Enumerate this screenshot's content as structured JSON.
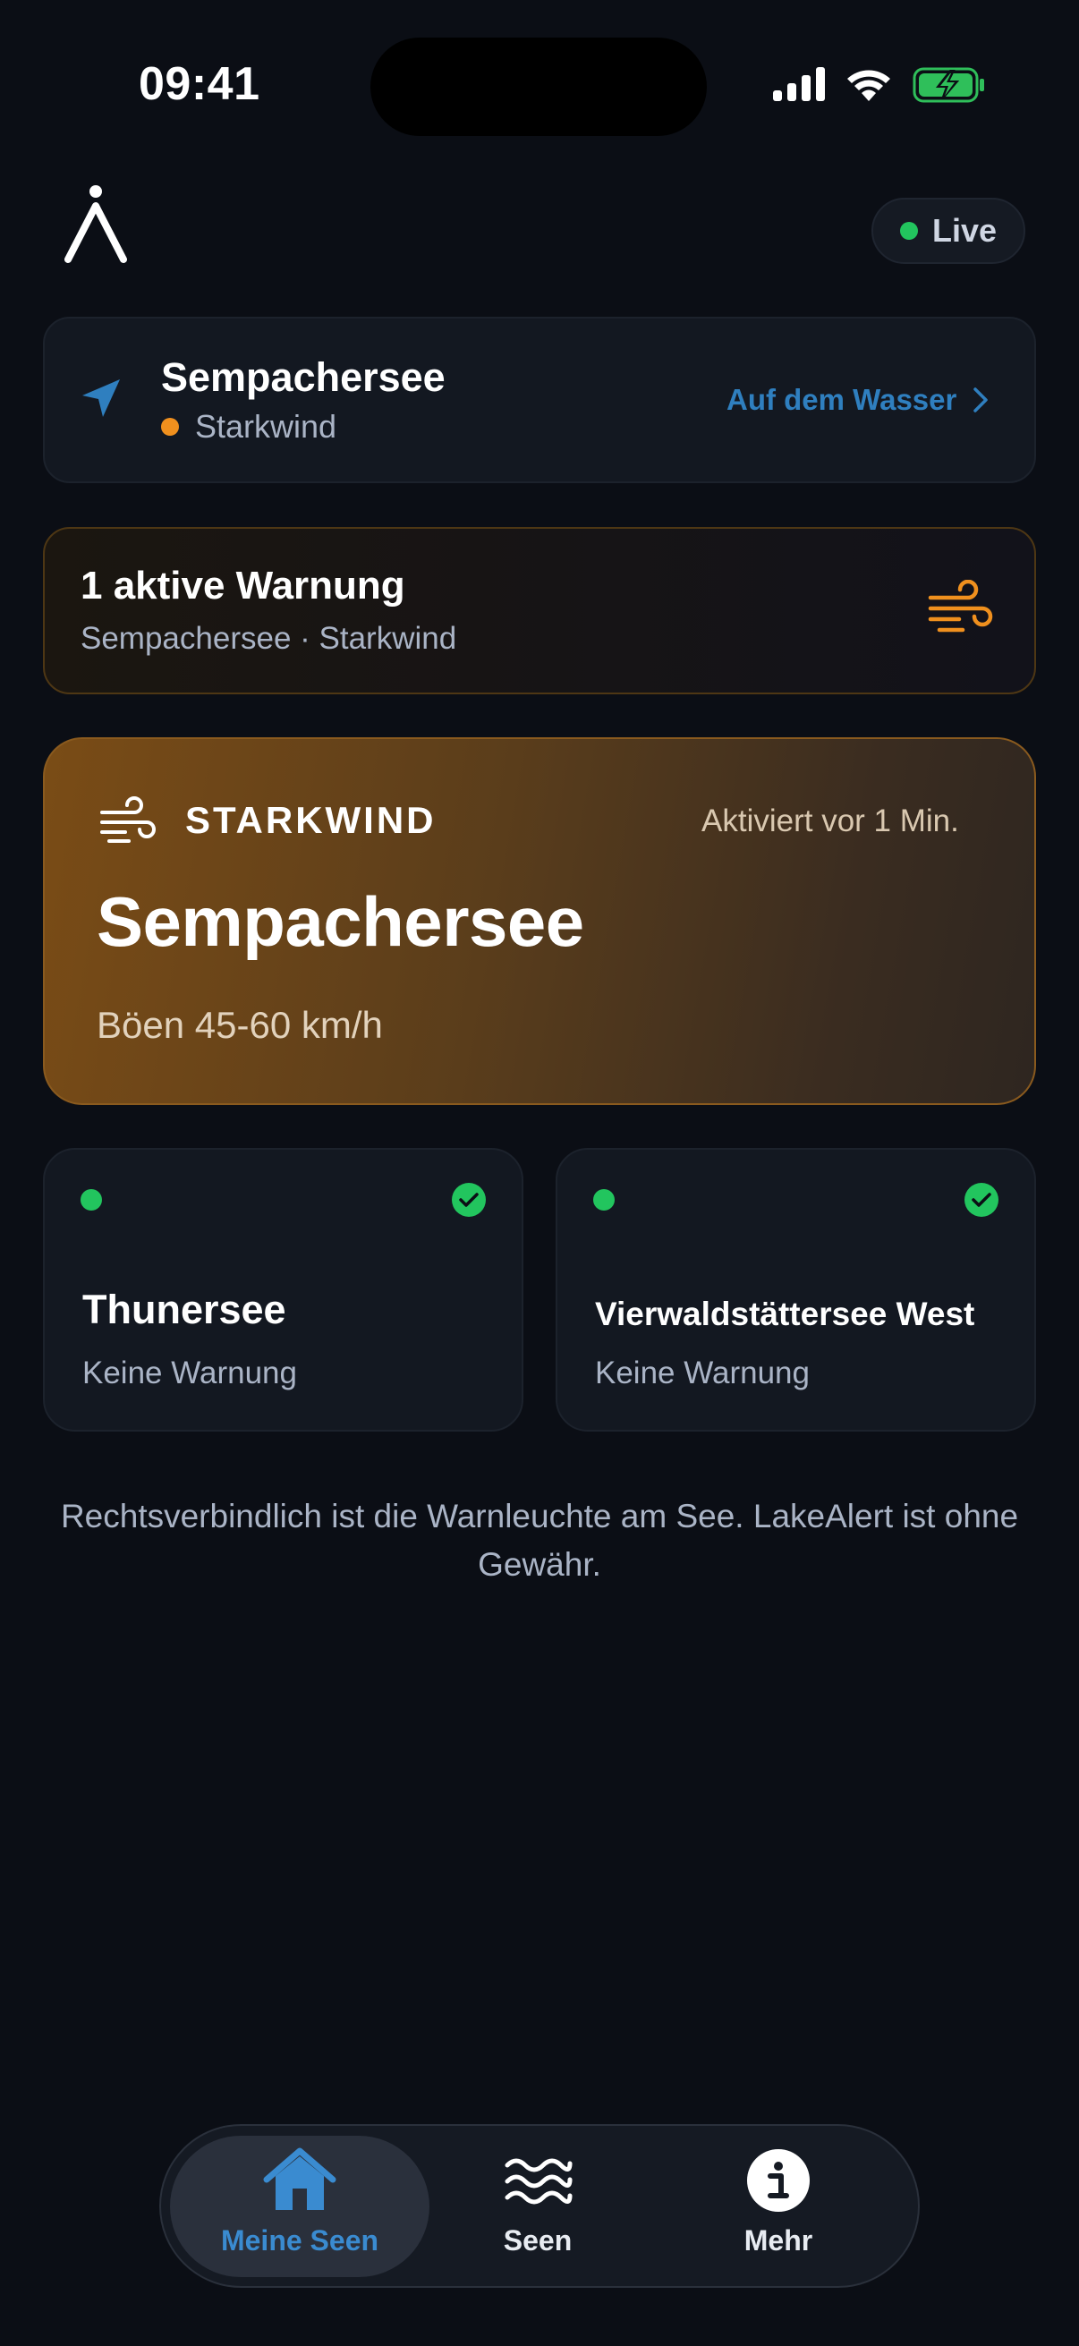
{
  "status_bar": {
    "time": "09:41"
  },
  "header": {
    "logo_icon": "a-ring-logo-icon",
    "live_label": "Live"
  },
  "location": {
    "lake": "Sempachersee",
    "status": "Starkwind",
    "status_color": "#f0901e",
    "action_label": "Auf dem Wasser"
  },
  "warning_summary": {
    "title": "1 aktive Warnung",
    "subtitle": "Sempachersee · Starkwind",
    "icon": "wind-icon"
  },
  "alert": {
    "type_label": "STARKWIND",
    "activated": "Aktiviert vor 1 Min.",
    "lake": "Sempachersee",
    "detail": "Böen 45-60 km/h"
  },
  "lakes": [
    {
      "name": "Thunersee",
      "status": "Keine Warnung",
      "status_color": "#22c55e"
    },
    {
      "name": "Vierwaldstättersee West",
      "status": "Keine Warnung",
      "status_color": "#22c55e"
    }
  ],
  "disclaimer": "Rechtsverbindlich ist die Warnleuchte am See. LakeAlert ist ohne Gewähr.",
  "tabs": [
    {
      "label": "Meine Seen",
      "icon": "home-icon",
      "active": true
    },
    {
      "label": "Seen",
      "icon": "waves-icon",
      "active": false
    },
    {
      "label": "Mehr",
      "icon": "info-icon",
      "active": false
    }
  ],
  "colors": {
    "accent_blue": "#3a8bd0",
    "warning_orange": "#f0901e",
    "ok_green": "#22c55e"
  }
}
